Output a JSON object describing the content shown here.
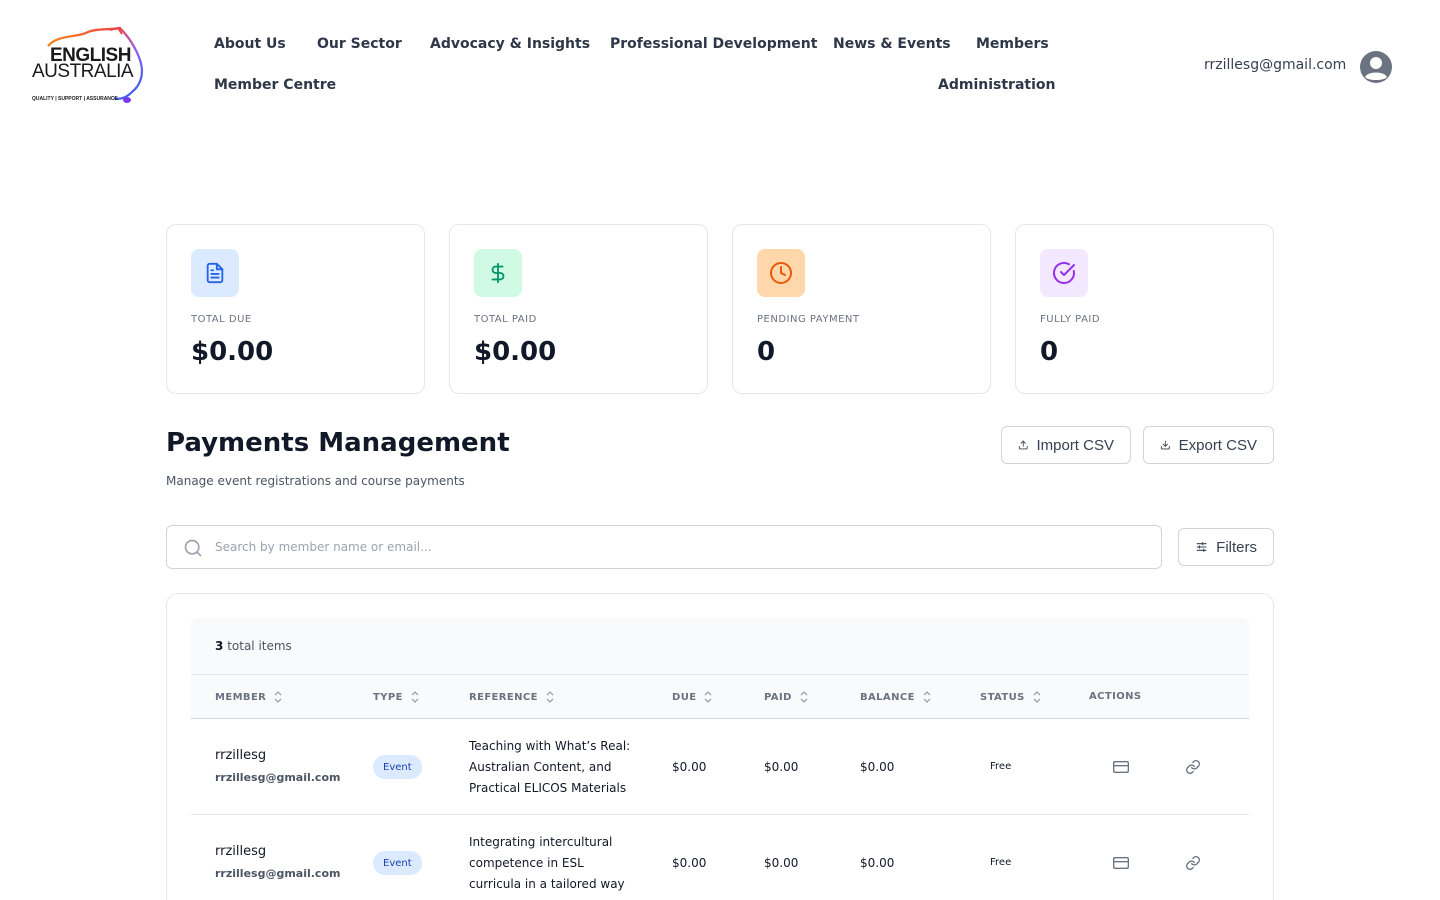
{
  "logo": {
    "line1": "ENGLISH",
    "line2": "AUSTRALIA",
    "tagline": "QUALITY | SUPPORT | ASSURANCE"
  },
  "nav": {
    "about": "About Us",
    "sector": "Our Sector",
    "advocacy": "Advocacy & Insights",
    "pd": "Professional Development",
    "news": "News & Events",
    "members": "Members",
    "member_centre": "Member Centre",
    "administration": "Administration"
  },
  "user": {
    "email": "rrzillesg@gmail.com"
  },
  "stats": [
    {
      "label": "TOTAL DUE",
      "value": "$0.00",
      "icon": "document-icon",
      "color": "#2563eb",
      "bg": "#dbeafe"
    },
    {
      "label": "TOTAL PAID",
      "value": "$0.00",
      "icon": "dollar-icon",
      "color": "#059669",
      "bg": "#d1fae5"
    },
    {
      "label": "PENDING PAYMENT",
      "value": "0",
      "icon": "clock-icon",
      "color": "#ea580c",
      "bg": "#fed7aa"
    },
    {
      "label": "FULLY PAID",
      "value": "0",
      "icon": "check-circle-icon",
      "color": "#9333ea",
      "bg": "#f3e8ff"
    }
  ],
  "page": {
    "title": "Payments Management",
    "subtitle": "Manage event registrations and course payments"
  },
  "toolbar": {
    "import_label": "Import CSV",
    "export_label": "Export CSV",
    "filters_label": "Filters"
  },
  "search": {
    "placeholder": "Search by member name or email..."
  },
  "table": {
    "total_count": "3",
    "total_suffix": "total items",
    "columns": {
      "member": "MEMBER",
      "type": "TYPE",
      "reference": "REFERENCE",
      "due": "DUE",
      "paid": "PAID",
      "balance": "BALANCE",
      "status": "STATUS",
      "actions": "ACTIONS"
    },
    "rows": [
      {
        "member_name": "rrzillesg",
        "member_email": "rrzillesg@gmail.com",
        "type": "Event",
        "reference_lines": [
          "Teaching with What’s Real:",
          "Australian Content, and",
          "Practical ELICOS Materials"
        ],
        "due": "$0.00",
        "paid": "$0.00",
        "balance": "$0.00",
        "status": "Free"
      },
      {
        "member_name": "rrzillesg",
        "member_email": "rrzillesg@gmail.com",
        "type": "Event",
        "reference_lines": [
          "Integrating intercultural",
          "competence in ESL",
          "curricula in a tailored way"
        ],
        "due": "$0.00",
        "paid": "$0.00",
        "balance": "$0.00",
        "status": "Free"
      }
    ]
  }
}
